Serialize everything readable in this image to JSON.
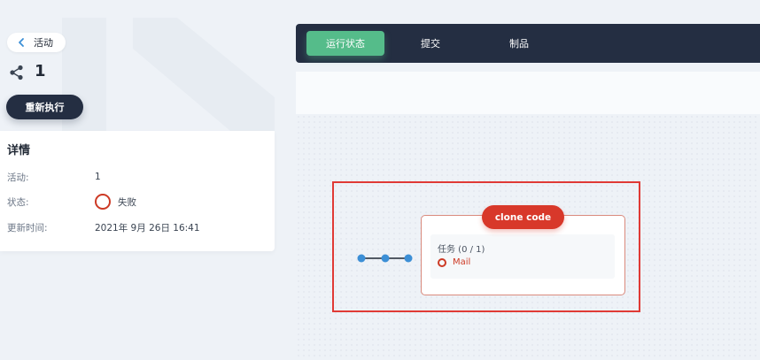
{
  "back": {
    "label": "活动"
  },
  "run": {
    "number": "1"
  },
  "rerun_button": {
    "label": "重新执行"
  },
  "details": {
    "title": "详情",
    "rows": [
      {
        "key": "活动:",
        "value": "1"
      },
      {
        "key": "状态:",
        "value": "失败"
      },
      {
        "key": "更新时间:",
        "value": "2021年 9月 26日 16:41"
      }
    ]
  },
  "tabs": [
    {
      "label": "运行状态",
      "active": true
    },
    {
      "label": "提交",
      "active": false
    },
    {
      "label": "制品",
      "active": false
    }
  ],
  "stage": {
    "name": "clone code",
    "task_title": "任务 (0 / 1)",
    "task_item": "Mail"
  },
  "icons": {
    "back": "chevron-left-icon",
    "pipeline": "pipeline-nodes-icon",
    "status": "failed-status-ring-icon",
    "task_status": "failed-status-ring-icon"
  },
  "colors": {
    "dark": "#242e42",
    "accent_green": "#55bc8a",
    "fail_red": "#d8382a",
    "highlight": "#e03a35",
    "node_blue": "#3c8fd6"
  }
}
